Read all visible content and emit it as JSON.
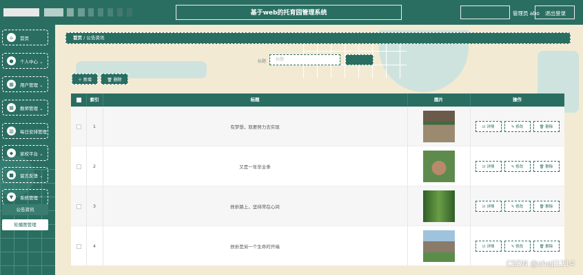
{
  "header": {
    "title": "基于web的托育园管理系统",
    "user_label": "管理员 abo",
    "logout_label": "退出登录"
  },
  "sidebar": {
    "items": [
      {
        "label": "首页",
        "icon": "home-icon",
        "glyph": "⌂"
      },
      {
        "label": "个人中心 ⌄",
        "icon": "user-icon",
        "glyph": "●"
      },
      {
        "label": "用户管理 ⌄",
        "icon": "grid-icon",
        "glyph": "▦"
      },
      {
        "label": "教师管理 ⌄",
        "icon": "grid-icon",
        "glyph": "▦"
      },
      {
        "label": "每日安排管理",
        "icon": "calendar-icon",
        "glyph": "▥"
      },
      {
        "label": "家校平台 ⌄",
        "icon": "location-icon",
        "glyph": "◆"
      },
      {
        "label": "留言反馈 ⌄",
        "icon": "message-icon",
        "glyph": "■"
      },
      {
        "label": "系统管理 ⌃",
        "icon": "shield-icon",
        "glyph": "▼"
      }
    ],
    "subitems": [
      "公告资讯",
      "轮播图管理"
    ]
  },
  "breadcrumb": {
    "home": "首页",
    "sep": "/",
    "current": "公告资讯"
  },
  "search": {
    "label": "标题",
    "placeholder": "标题",
    "button_label": ""
  },
  "toolbar": {
    "add_label": "＋ 新增",
    "delete_label": "🗑 删除"
  },
  "table": {
    "headers": [
      "索引",
      "标题",
      "图片",
      "操作"
    ],
    "rows": [
      {
        "index": "1",
        "title": "有梦想，就要努力去实现"
      },
      {
        "index": "2",
        "title": "又是一年毕业季"
      },
      {
        "index": "3",
        "title": "挫折路上，坚持常在心间"
      },
      {
        "index": "4",
        "title": "挫折是另一个生命的开端"
      }
    ],
    "actions": {
      "detail": "☑ 详情",
      "edit": "✎ 修改",
      "delete": "🗑 删除"
    }
  },
  "watermark": "CSDN @sheji1214",
  "colors": {
    "primary": "#2a6e62",
    "background": "#f3ead3"
  }
}
